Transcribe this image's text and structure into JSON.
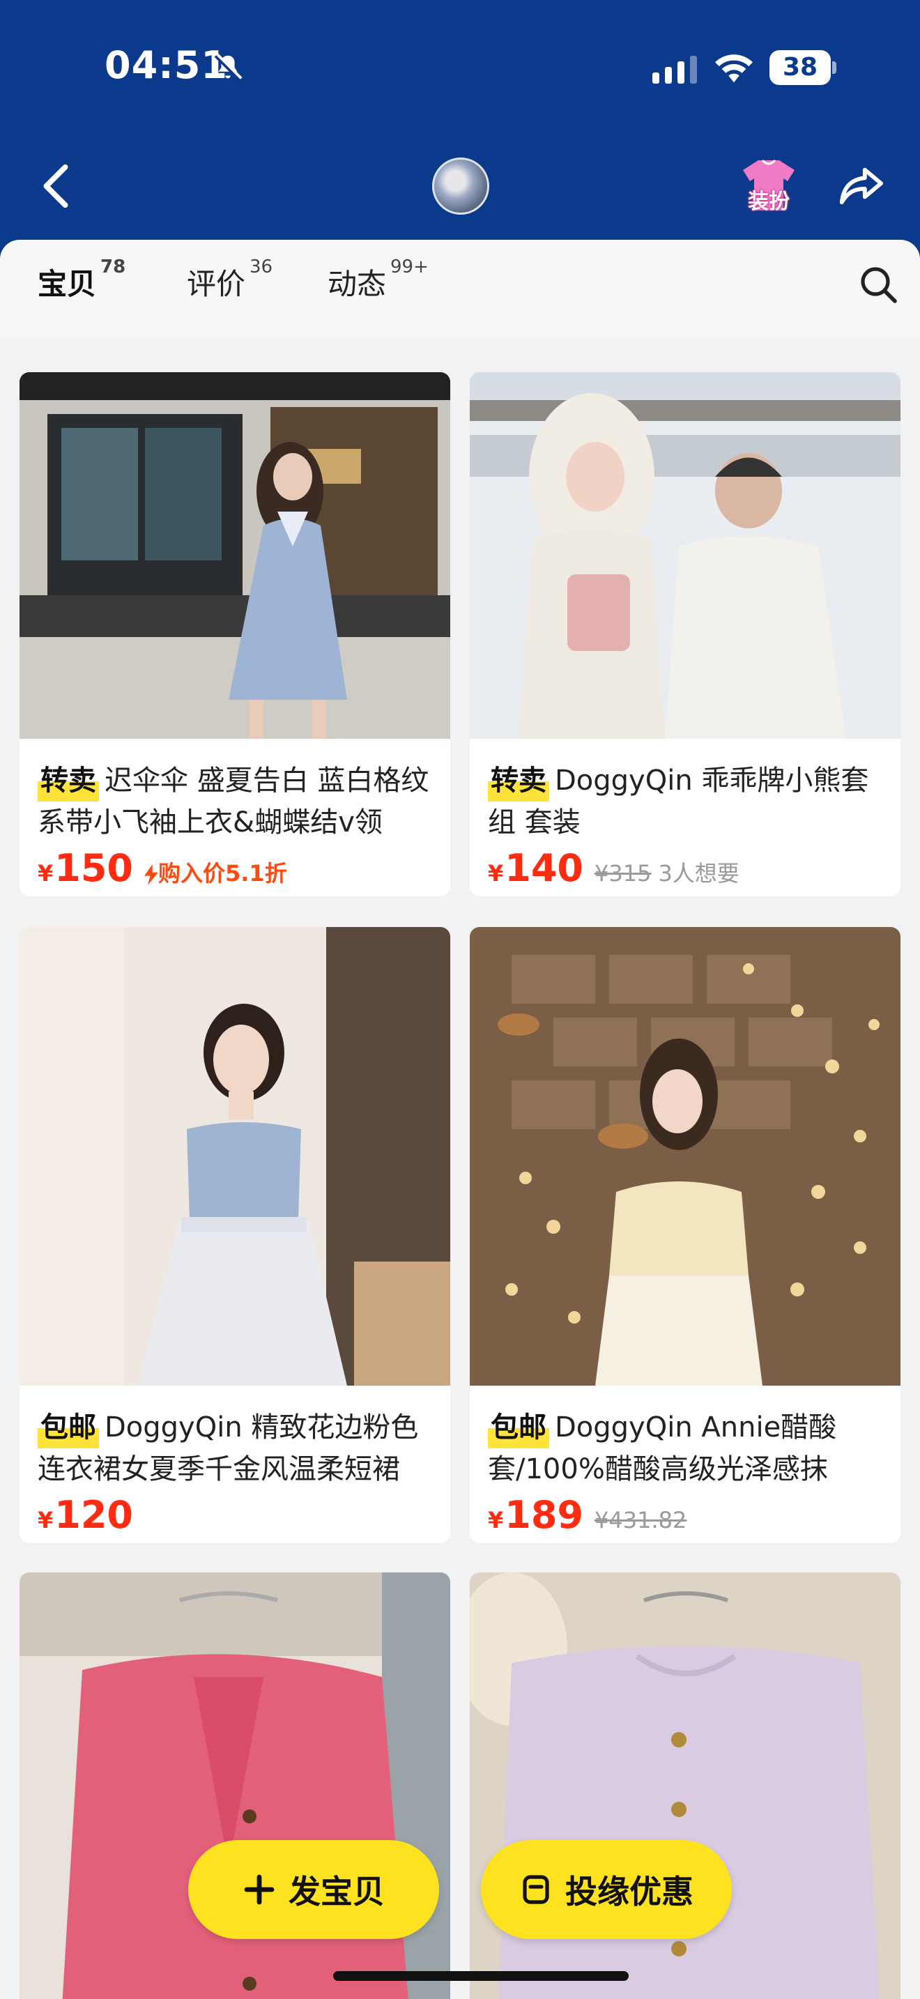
{
  "status_bar": {
    "time": "04:51",
    "battery": "38"
  },
  "nav": {
    "dress_label": "装扮"
  },
  "tabs": [
    {
      "label": "宝贝",
      "count": "78"
    },
    {
      "label": "评价",
      "count": "36"
    },
    {
      "label": "动态",
      "count": "99+"
    }
  ],
  "products": [
    {
      "tag": "转卖",
      "title": "迟伞伞 盛夏告白 蓝白格纹系带小飞袖上衣&蝴蝶结v领",
      "currency": "¥",
      "price": "150",
      "deal": "购入价5.1折",
      "original": "",
      "want": ""
    },
    {
      "tag": "转卖",
      "title": "DoggyQin 乖乖牌小熊套组 套装",
      "currency": "¥",
      "price": "140",
      "deal": "",
      "original": "¥315",
      "want": "3人想要"
    },
    {
      "tag": "包邮",
      "title": "DoggyQin 精致花边粉色连衣裙女夏季千金风温柔短裙",
      "currency": "¥",
      "price": "120",
      "deal": "",
      "original": "",
      "want": ""
    },
    {
      "tag": "包邮",
      "title": "DoggyQin Annie醋酸套/100%醋酸高级光泽感抹",
      "currency": "¥",
      "price": "189",
      "deal": "",
      "original": "¥431.82",
      "want": ""
    }
  ],
  "fab": {
    "publish": "发宝贝",
    "promo": "投缘优惠"
  },
  "colors": {
    "header": "#0b3a8c",
    "accent": "#ffe21f",
    "price": "#ff2c12"
  }
}
